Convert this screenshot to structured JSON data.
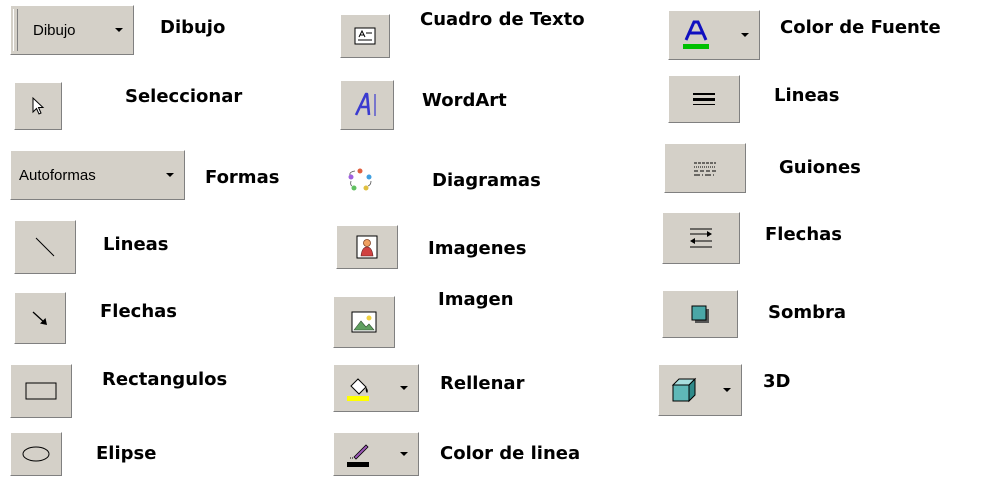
{
  "col1": {
    "dibujo_button": "Dibujo",
    "dibujo_label": "Dibujo",
    "seleccionar_label": "Seleccionar",
    "autoformas_button": "Autoformas",
    "formas_label": "Formas",
    "lineas_label": "Lineas",
    "flechas_label": "Flechas",
    "rectangulos_label": "Rectangulos",
    "elipse_label": "Elipse"
  },
  "col2": {
    "cuadro_label": "Cuadro de Texto",
    "wordart_label": "WordArt",
    "diagramas_label": "Diagramas",
    "imagenes_label": "Imagenes",
    "imagen_label": "Imagen",
    "rellenar_label": "Rellenar",
    "color_linea_label": "Color de linea"
  },
  "col3": {
    "color_fuente_label": "Color de Fuente",
    "lineas_label": "Lineas",
    "guiones_label": "Guiones",
    "flechas_label": "Flechas",
    "sombra_label": "Sombra",
    "tresd_label": "3D"
  },
  "colors": {
    "button_face": "#d4d0c8",
    "font_color_bar": "#00c000",
    "fill_color_bar": "#ffff00",
    "line_color_bar": "#000000",
    "shadow_fill": "#4aa7a7",
    "threed_fill": "#5fb8b8",
    "wordart_blue": "#3b3bd0"
  },
  "icons": [
    "pointer-icon",
    "line-icon",
    "arrow-icon",
    "rectangle-icon",
    "oval-icon",
    "textbox-icon",
    "wordart-icon",
    "diagram-icon",
    "clipart-icon",
    "picture-icon",
    "fill-color-icon",
    "line-color-icon",
    "font-color-icon",
    "line-style-icon",
    "dash-style-icon",
    "arrow-style-icon",
    "shadow-style-icon",
    "3d-style-icon"
  ]
}
